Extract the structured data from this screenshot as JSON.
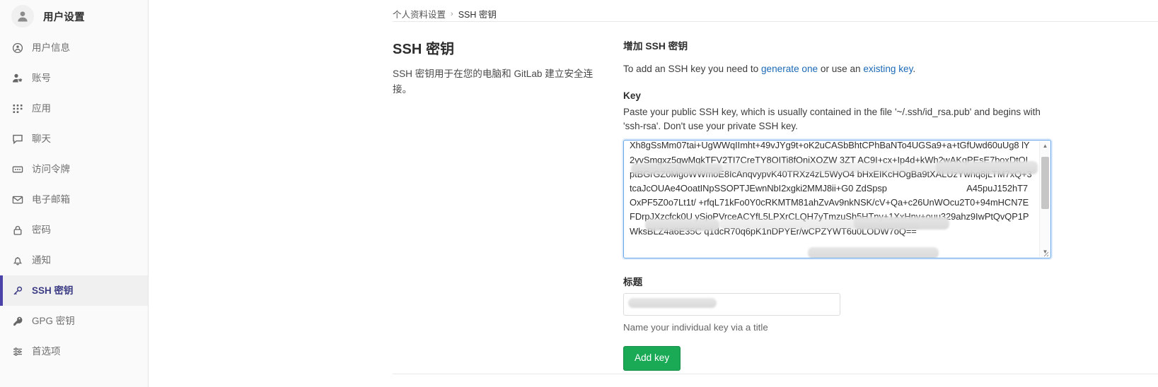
{
  "sidebar": {
    "header": {
      "title": "用户设置",
      "avatar_icon": "user-avatar-icon"
    },
    "items": [
      {
        "label": "用户信息",
        "icon": "user-circle-icon",
        "active": false
      },
      {
        "label": "账号",
        "icon": "account-gear-icon",
        "active": false
      },
      {
        "label": "应用",
        "icon": "apps-grid-icon",
        "active": false
      },
      {
        "label": "聊天",
        "icon": "chat-bubble-icon",
        "active": false
      },
      {
        "label": "访问令牌",
        "icon": "access-token-icon",
        "active": false
      },
      {
        "label": "电子邮箱",
        "icon": "envelope-icon",
        "active": false
      },
      {
        "label": "密码",
        "icon": "lock-icon",
        "active": false
      },
      {
        "label": "通知",
        "icon": "bell-icon",
        "active": false
      },
      {
        "label": "SSH 密钥",
        "icon": "key-icon",
        "active": true
      },
      {
        "label": "GPG 密钥",
        "icon": "key-icon",
        "active": false
      },
      {
        "label": "首选项",
        "icon": "sliders-icon",
        "active": false
      }
    ]
  },
  "breadcrumb": {
    "parent": "个人资料设置",
    "separator": "›",
    "current": "SSH 密钥"
  },
  "page": {
    "heading": "SSH 密钥",
    "description": "SSH 密钥用于在您的电脑和 GitLab 建立安全连接。"
  },
  "form": {
    "heading": "增加 SSH 密钥",
    "intro_prefix": "To add an SSH key you need to ",
    "intro_link1": "generate one",
    "intro_middle": " or use an ",
    "intro_link2": "existing key",
    "intro_suffix": ".",
    "key_label": "Key",
    "key_help": "Paste your public SSH key, which is usually contained in the file '~/.ssh/id_rsa.pub' and begins with 'ssh-rsa'. Don't use your private SSH key.",
    "key_value": "Xh8gSsMm07tai+UgWWqIImht+49vJYg9t+oK2uCASbBhtCPhBaNTo4UGSa9+a+tGfUwd60uUg8 lY                          2yvSmgxz5qwMqkTFV2TI7CreTY8OITi8fOniXOZW 3ZT AC9I+cx+Ip4d+kWh2wAKqPEsE7boxDtOIptBGrGZ0MgoWWmoE8IcAnqvypvK40TRXz4zL5WyO4 bHxEIKcHOgBa9tXALUzYwhq8jLTM7xQ+3tcaJcOUAe4OoatINpSSOPTJEwnNbI2xgki2MMJ8ii+G0 ZdSpsp                                A45puJ152hT7OxPF5Z0o7Lt1t/ +rfqL71kFo0Y0cRKMTM81ahZvAv9nkNSK/cV+Qa+c26UnWOcu2T0+94mHCN7EFDrpJXzcfck0U ySjoPVrceACYfL5LPXrCLQH7yTmzuSh5HTny+1XxHnv+ouu329ahz9IwPtQvQP1PWksBLZ4a6E35C q1dcR70q6pK1nDPYEr/wCPZYWT6u0LODW7oQ==",
    "title_label": "标题",
    "title_value": "",
    "title_help": "Name your individual key via a title",
    "submit_label": "Add key",
    "scrollbar_up": "▲",
    "scrollbar_down": "▼"
  },
  "colors": {
    "accent_green": "#1aaa55",
    "link_blue": "#1b69b6",
    "active_nav": "#4a42a8",
    "focus_border": "#6aa7e8"
  }
}
